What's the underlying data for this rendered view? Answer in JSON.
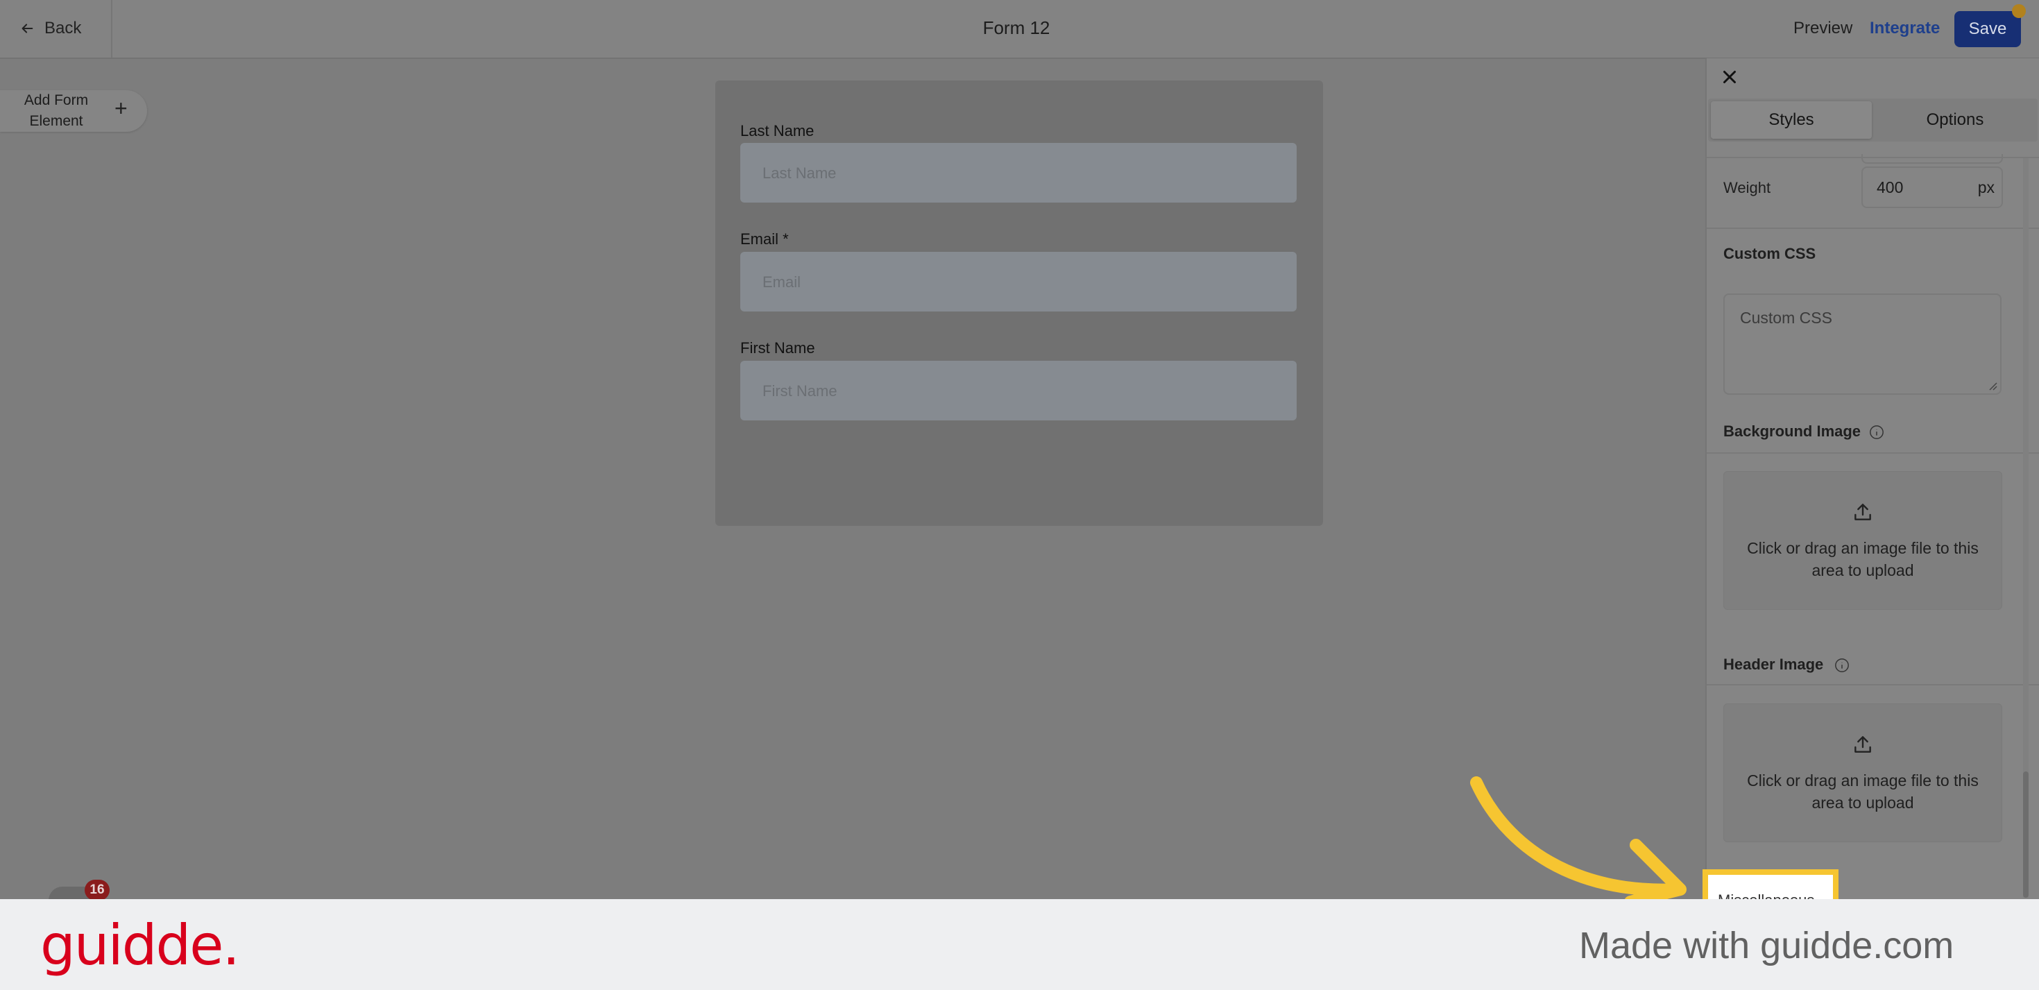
{
  "topbar": {
    "back_label": "Back",
    "form_title": "Form 12",
    "preview_label": "Preview",
    "integrate_label": "Integrate",
    "save_label": "Save"
  },
  "builder": {
    "add_element_label": "Add Form Element",
    "add_element_icon": "plus-icon"
  },
  "form": {
    "fields": [
      {
        "label": "Last Name",
        "placeholder": "Last Name"
      },
      {
        "label": "Email *",
        "placeholder": "Email"
      },
      {
        "label": "First Name",
        "placeholder": "First Name"
      }
    ]
  },
  "panel": {
    "tabs": [
      {
        "label": "Styles",
        "active": true
      },
      {
        "label": "Options",
        "active": false
      }
    ],
    "weight_label": "Weight",
    "weight_value": "400",
    "weight_unit": "px",
    "custom_css_heading": "Custom CSS",
    "custom_css_placeholder": "Custom CSS",
    "background_image_heading": "Background Image",
    "header_image_heading": "Header Image",
    "upload_text": "Click or drag an image file to this area to upload",
    "miscellaneous_label": "Miscellaneous"
  },
  "notifications": {
    "count": "16"
  },
  "footer": {
    "brand": "guidde.",
    "tagline": "Made with guidde.com"
  },
  "colors": {
    "accent": "#1e3f8c",
    "highlight": "#f6c531",
    "brand": "#d8001c"
  }
}
